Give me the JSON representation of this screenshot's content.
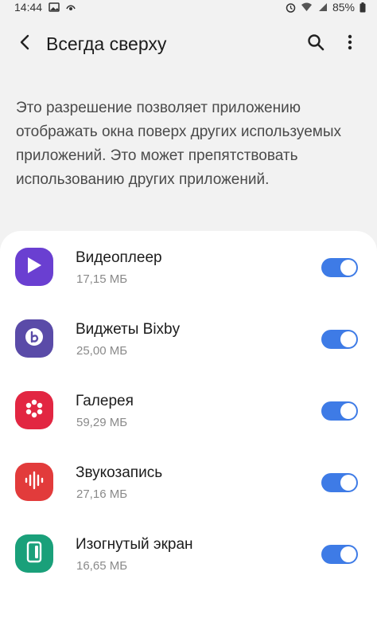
{
  "status_bar": {
    "time": "14:44",
    "battery": "85%",
    "icons": [
      "image-icon",
      "eye-icon",
      "alarm-icon",
      "wifi-icon",
      "signal-icon",
      "battery-icon"
    ]
  },
  "header": {
    "title": "Всегда сверху",
    "back_icon": "back-arrow-icon",
    "search_icon": "search-icon",
    "more_icon": "more-vert-icon"
  },
  "description": "Это разрешение позволяет приложению отображать окна поверх других используемых приложений. Это может препятствовать использованию других приложений.",
  "colors": {
    "toggle_on": "#3e7be6",
    "videoplayer": "#6a3fd1",
    "bixby_widgets": "#5a4ba8",
    "gallery": "#e22642",
    "voice_recorder": "#e23b3b",
    "edge_screen": "#1aa07a"
  },
  "apps": [
    {
      "name": "Видеоплеер",
      "size": "17,15 МБ",
      "enabled": true,
      "icon": "play-icon"
    },
    {
      "name": "Виджеты Bixby",
      "size": "25,00 МБ",
      "enabled": true,
      "icon": "bixby-icon"
    },
    {
      "name": "Галерея",
      "size": "59,29 МБ",
      "enabled": true,
      "icon": "flower-icon"
    },
    {
      "name": "Звукозапись",
      "size": "27,16 МБ",
      "enabled": true,
      "icon": "waveform-icon"
    },
    {
      "name": "Изогнутый экран",
      "size": "16,65 МБ",
      "enabled": true,
      "icon": "edge-panel-icon"
    }
  ]
}
